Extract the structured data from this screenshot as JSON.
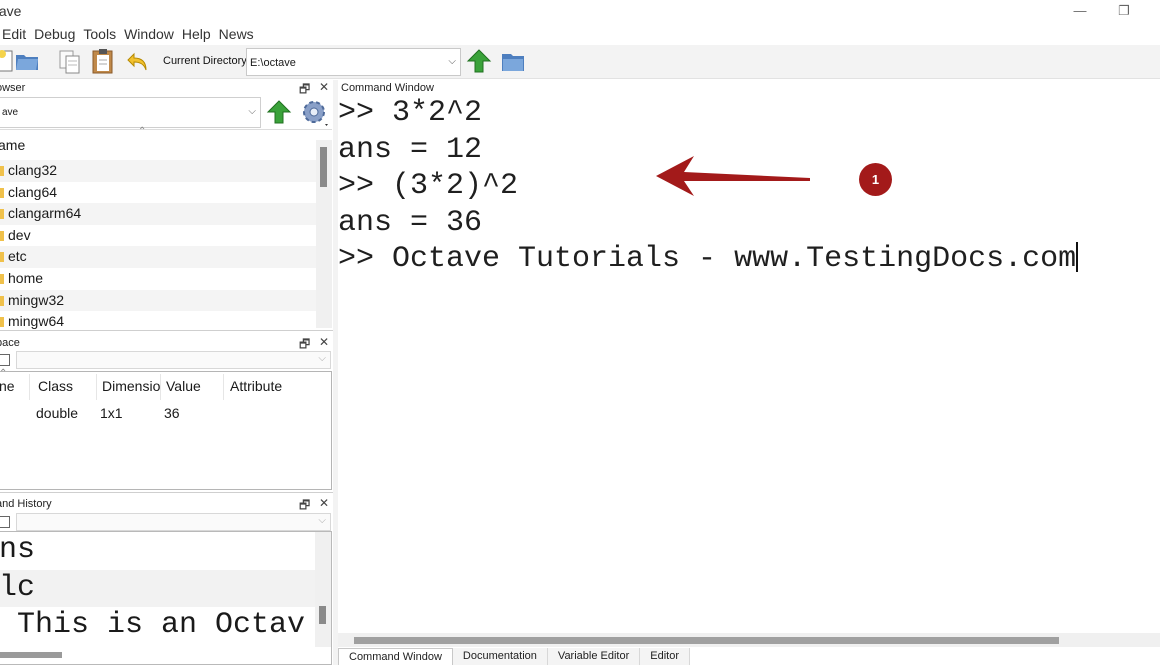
{
  "window": {
    "title": "ctave",
    "minimize_glyph": "—",
    "restore_glyph": "❐"
  },
  "menu": [
    "Edit",
    "Debug",
    "Tools",
    "Window",
    "Help",
    "News"
  ],
  "toolbar": {
    "current_directory_label": "Current Directory:",
    "current_directory_value": "E:\\octave"
  },
  "file_browser": {
    "title": "owser",
    "path_value": "ave",
    "column_header": "ame",
    "items": [
      "clang32",
      "clang64",
      "clangarm64",
      "dev",
      "etc",
      "home",
      "mingw32",
      "mingw64"
    ]
  },
  "workspace": {
    "title": "pace",
    "columns": [
      "ne",
      "Class",
      "Dimensio",
      "Value",
      "Attribute"
    ],
    "rows": [
      {
        "name": "",
        "class": "double",
        "dimension": "1x1",
        "value": "36",
        "attribute": ""
      }
    ]
  },
  "command_history": {
    "title": "and History",
    "items": [
      "ns",
      "lc",
      " This is an Octav"
    ]
  },
  "command_window": {
    "title": "Command Window",
    "lines": [
      ">> 3*2^2",
      "ans = 12",
      ">> (3*2)^2",
      "ans = 36",
      ">> Octave Tutorials - www.TestingDocs.com"
    ]
  },
  "annotation": {
    "badge_number": "1",
    "color": "#a31a1a"
  },
  "bottom_tabs": [
    "Command Window",
    "Documentation",
    "Variable Editor",
    "Editor"
  ],
  "panel_controls": {
    "undock": "🗗",
    "close": "✕"
  },
  "colors": {
    "toolbar_bg": "#f3f3f3",
    "arrow_green": "#3aa23a",
    "folder_yellow": "#f0c14b",
    "annotation_red": "#a31a1a"
  }
}
